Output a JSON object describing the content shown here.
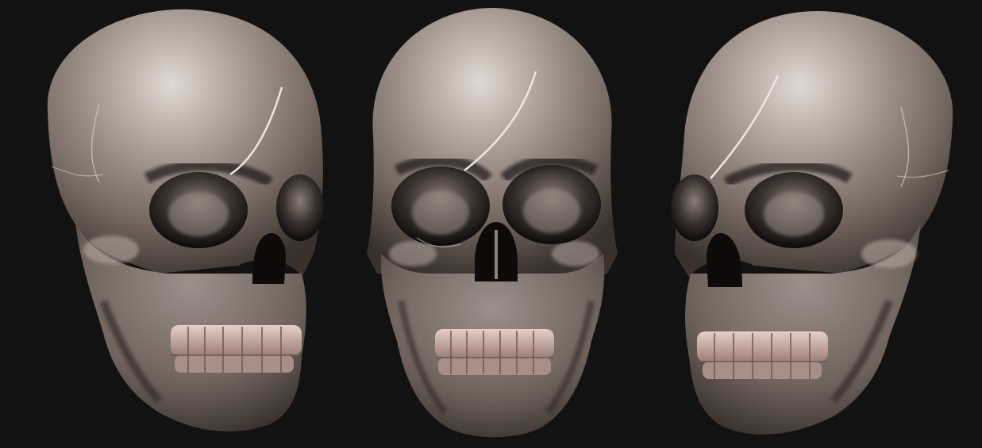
{
  "scene": {
    "background_color": "#121212",
    "subject": "sculpted-skull",
    "views": [
      {
        "id": "left-three-quarter",
        "angle": "three-quarter-left"
      },
      {
        "id": "front",
        "angle": "front"
      },
      {
        "id": "right-three-quarter",
        "angle": "three-quarter-right"
      }
    ],
    "colors": {
      "bone_highlight": "#ddd4cc",
      "bone_mid": "#8e817a",
      "bone_shadow": "#3b3330",
      "socket_dark": "#0c0909",
      "teeth": "#d8b8ad",
      "scar": "#e8e0da"
    }
  }
}
